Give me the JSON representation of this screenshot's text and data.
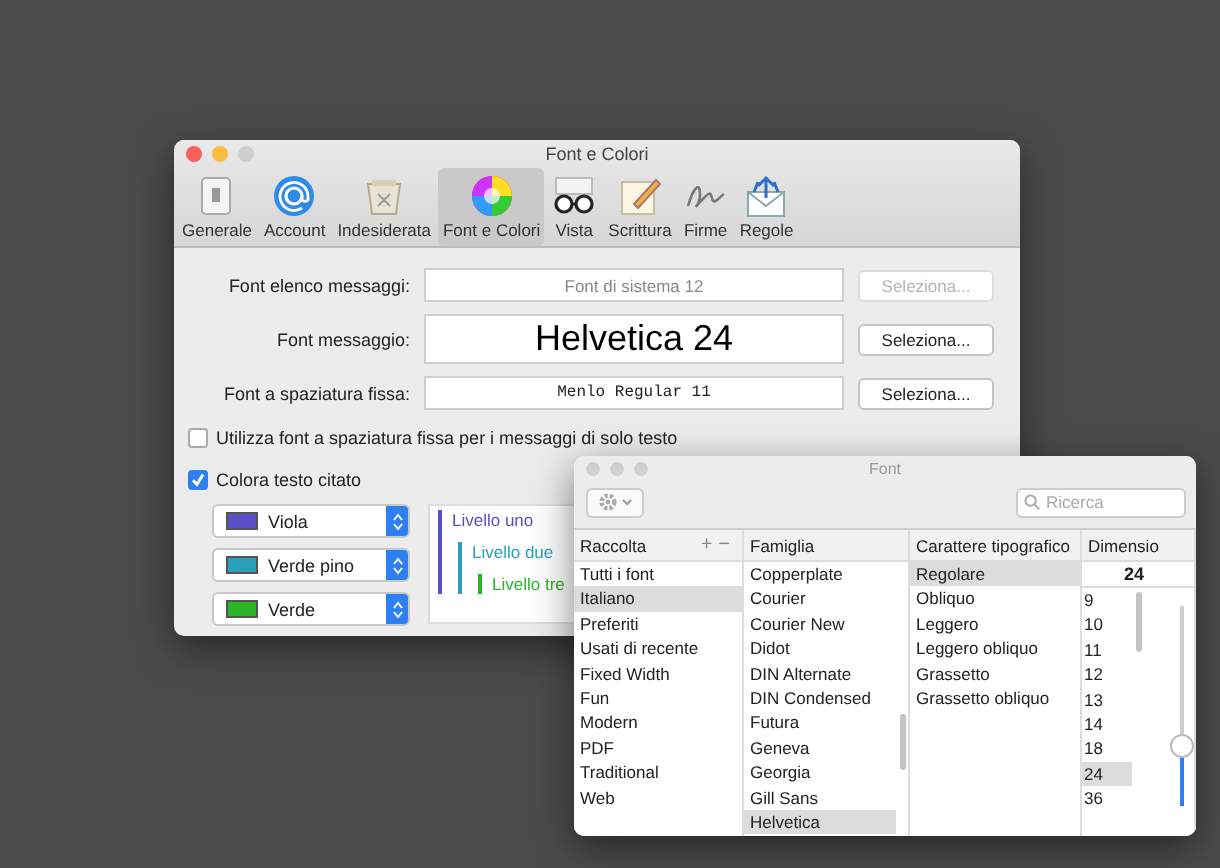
{
  "prefs_window": {
    "title": "Font e Colori",
    "toolbar": [
      {
        "label": "Generale",
        "selected": false
      },
      {
        "label": "Account",
        "selected": false
      },
      {
        "label": "Indesiderata",
        "selected": false
      },
      {
        "label": "Font e Colori",
        "selected": true
      },
      {
        "label": "Vista",
        "selected": false
      },
      {
        "label": "Scrittura",
        "selected": false
      },
      {
        "label": "Firme",
        "selected": false
      },
      {
        "label": "Regole",
        "selected": false
      }
    ],
    "font_rows": [
      {
        "label": "Font elenco messaggi:",
        "value": "Font di sistema 12",
        "kind": "system",
        "button": "Seleziona...",
        "disabled": true
      },
      {
        "label": "Font messaggio:",
        "value": "Helvetica 24",
        "kind": "large",
        "button": "Seleziona...",
        "disabled": false
      },
      {
        "label": "Font a spaziatura fissa:",
        "value": "Menlo Regular 11",
        "kind": "mono",
        "button": "Seleziona...",
        "disabled": false
      }
    ],
    "checkboxes": [
      {
        "label": "Utilizza font a spaziatura fissa per i messaggi di solo testo",
        "checked": false
      },
      {
        "label": "Colora testo citato",
        "checked": true
      }
    ],
    "quote_colors": [
      {
        "name": "Viola",
        "color": "#5a4fc6"
      },
      {
        "name": "Verde pino",
        "color": "#2aa0b8"
      },
      {
        "name": "Verde",
        "color": "#2db52a"
      }
    ],
    "preview": [
      "Livello uno",
      "Livello due",
      "Livello tre"
    ]
  },
  "font_panel": {
    "title": "Font",
    "search": {
      "placeholder": "Ricerca"
    },
    "columns": [
      "Raccolta",
      "Famiglia",
      "Carattere tipografico",
      "Dimensio"
    ],
    "collection_buttons": [
      "+",
      "−"
    ],
    "collections": [
      {
        "label": "Tutti i font",
        "selected": false
      },
      {
        "label": "Italiano",
        "selected": true
      },
      {
        "label": "Preferiti",
        "selected": false
      },
      {
        "label": "Usati di recente",
        "selected": false
      },
      {
        "label": "Fixed Width",
        "selected": false
      },
      {
        "label": "Fun",
        "selected": false
      },
      {
        "label": "Modern",
        "selected": false
      },
      {
        "label": "PDF",
        "selected": false
      },
      {
        "label": "Traditional",
        "selected": false
      },
      {
        "label": "Web",
        "selected": false
      }
    ],
    "families": [
      {
        "label": "Copperplate",
        "selected": false
      },
      {
        "label": "Courier",
        "selected": false
      },
      {
        "label": "Courier New",
        "selected": false
      },
      {
        "label": "Didot",
        "selected": false
      },
      {
        "label": "DIN Alternate",
        "selected": false
      },
      {
        "label": "DIN Condensed",
        "selected": false
      },
      {
        "label": "Futura",
        "selected": false
      },
      {
        "label": "Geneva",
        "selected": false
      },
      {
        "label": "Georgia",
        "selected": false
      },
      {
        "label": "Gill Sans",
        "selected": false
      },
      {
        "label": "Helvetica",
        "selected": true
      }
    ],
    "typefaces": [
      {
        "label": "Regolare",
        "selected": true
      },
      {
        "label": "Obliquo",
        "selected": false
      },
      {
        "label": "Leggero",
        "selected": false
      },
      {
        "label": "Leggero obliquo",
        "selected": false
      },
      {
        "label": "Grassetto",
        "selected": false
      },
      {
        "label": "Grassetto obliquo",
        "selected": false
      }
    ],
    "size": {
      "value": "24",
      "level": 0.3,
      "options": [
        {
          "label": "9",
          "selected": false
        },
        {
          "label": "10",
          "selected": false
        },
        {
          "label": "11",
          "selected": false
        },
        {
          "label": "12",
          "selected": false
        },
        {
          "label": "13",
          "selected": false
        },
        {
          "label": "14",
          "selected": false
        },
        {
          "label": "18",
          "selected": false
        },
        {
          "label": "24",
          "selected": true
        },
        {
          "label": "36",
          "selected": false
        }
      ]
    }
  }
}
